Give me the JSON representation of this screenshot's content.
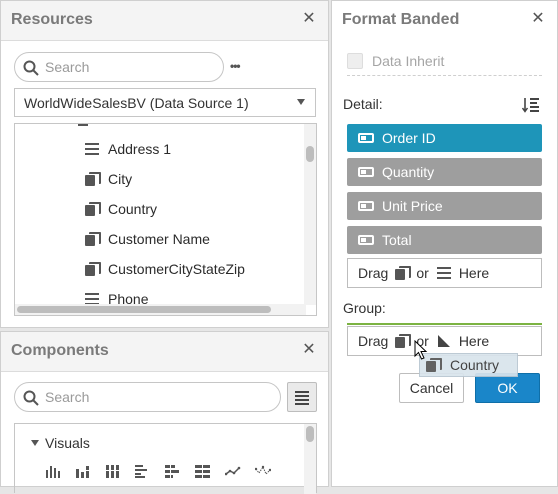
{
  "resources": {
    "title": "Resources",
    "search_placeholder": "Search",
    "more_label": "•••",
    "data_source": "WorldWideSalesBV (Data Source 1)",
    "items": [
      {
        "label": "Address 1",
        "icon": "field-icon"
      },
      {
        "label": "City",
        "icon": "dimension-icon"
      },
      {
        "label": "Country",
        "icon": "dimension-icon"
      },
      {
        "label": "Customer Name",
        "icon": "dimension-icon"
      },
      {
        "label": "CustomerCityStateZip",
        "icon": "dimension-icon"
      },
      {
        "label": "Phone",
        "icon": "field-icon"
      }
    ]
  },
  "components": {
    "title": "Components",
    "search_placeholder": "Search",
    "group_label": "Visuals",
    "visual_icons": [
      "column-chart-icon",
      "stacked-column-icon",
      "100-stacked-column-icon",
      "bar-chart-icon",
      "stacked-bar-icon",
      "100-stacked-bar-icon",
      "line-chart-icon",
      "scatter-chart-icon"
    ]
  },
  "format": {
    "title": "Format Banded",
    "data_inherit": "Data Inherit",
    "detail_label": "Detail:",
    "detail_fields": [
      "Order ID",
      "Quantity",
      "Unit Price",
      "Total"
    ],
    "drag_word": "Drag",
    "or_word": "or",
    "here_word": "Here",
    "group_label": "Group:",
    "drag_ghost": "Country",
    "cancel": "Cancel",
    "ok": "OK"
  },
  "colors": {
    "accent": "#1e95b9",
    "chip_gray": "#9e9e9e",
    "ok_blue": "#1a86c9",
    "group_line": "#7cb342"
  }
}
